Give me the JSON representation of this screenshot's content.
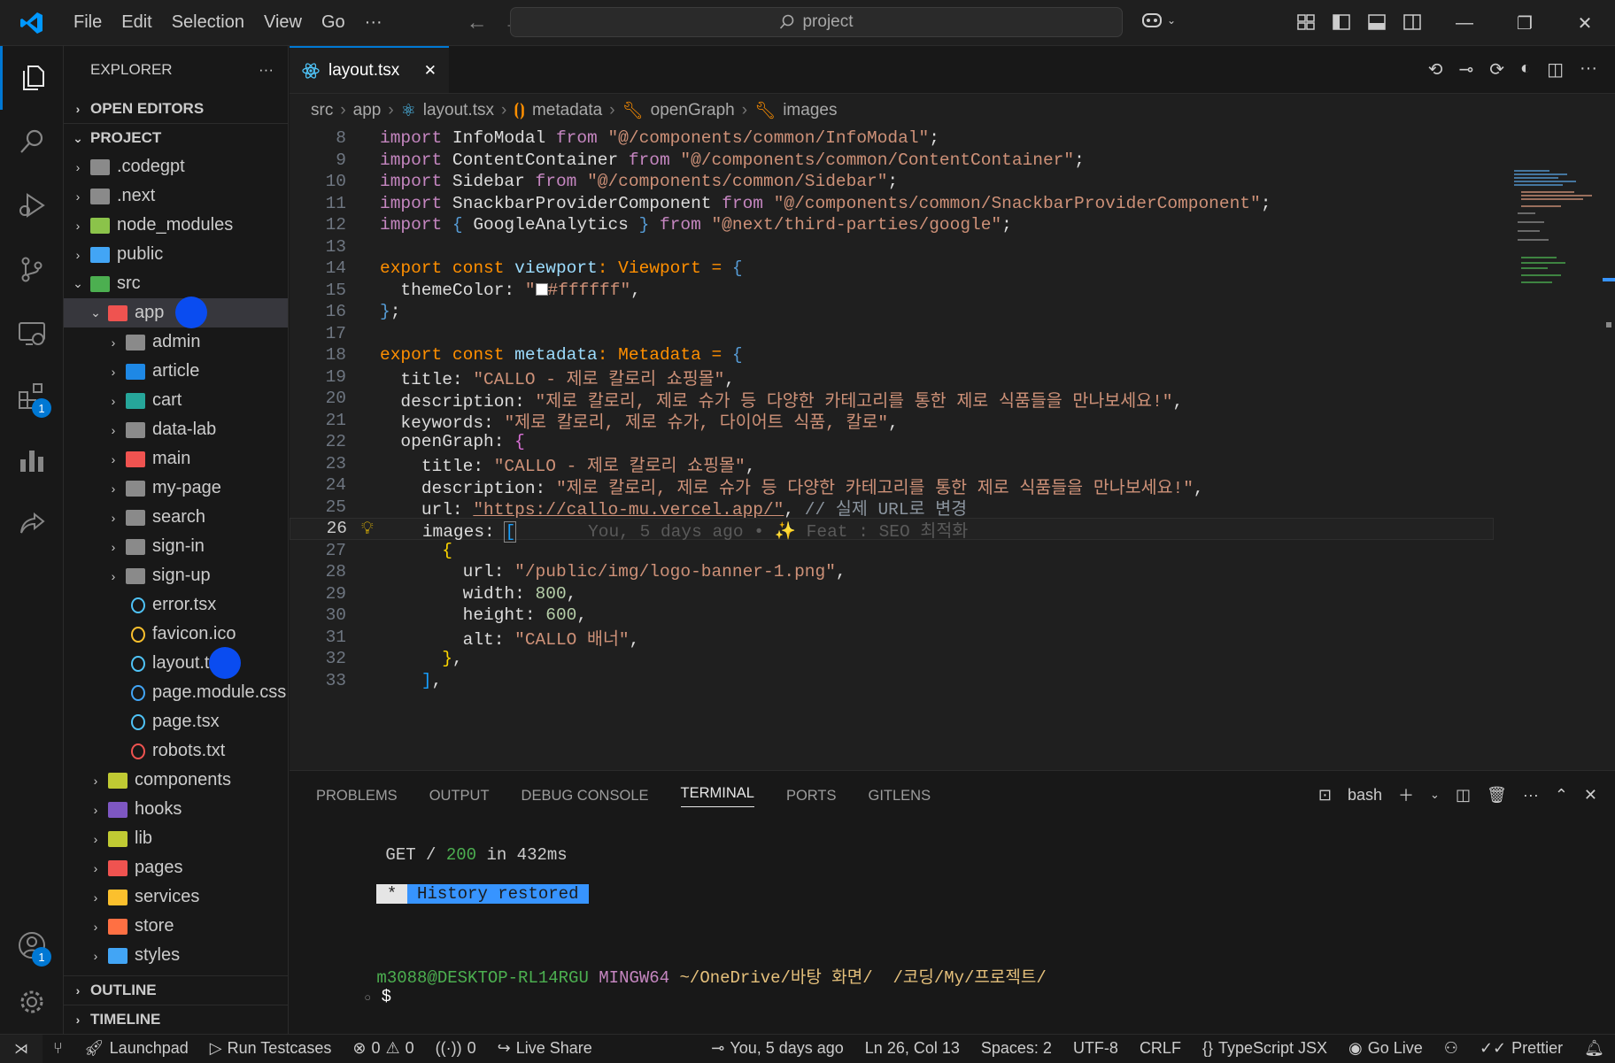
{
  "menu": [
    "File",
    "Edit",
    "Selection",
    "View",
    "Go",
    "···"
  ],
  "command_center": "project",
  "explorer": {
    "title": "EXPLORER",
    "more": "···",
    "open_editors": "OPEN EDITORS",
    "project": "PROJECT",
    "outline": "OUTLINE",
    "timeline": "TIMELINE",
    "tree": [
      {
        "label": ".codegpt",
        "level": 1,
        "chev": "›",
        "color": "#8a8a8a"
      },
      {
        "label": ".next",
        "level": 1,
        "chev": "›",
        "color": "#8a8a8a"
      },
      {
        "label": "node_modules",
        "level": 1,
        "chev": "›",
        "color": "#8bc34a"
      },
      {
        "label": "public",
        "level": 1,
        "chev": "›",
        "color": "#42a5f5"
      },
      {
        "label": "src",
        "level": 1,
        "chev": "⌄",
        "color": "#4caf50"
      },
      {
        "label": "app",
        "level": 2,
        "chev": "⌄",
        "color": "#ef5350",
        "selected": true
      },
      {
        "label": "admin",
        "level": 3,
        "chev": "›",
        "color": "#8a8a8a"
      },
      {
        "label": "article",
        "level": 3,
        "chev": "›",
        "color": "#1e88e5"
      },
      {
        "label": "cart",
        "level": 3,
        "chev": "›",
        "color": "#26a69a"
      },
      {
        "label": "data-lab",
        "level": 3,
        "chev": "›",
        "color": "#8a8a8a"
      },
      {
        "label": "main",
        "level": 3,
        "chev": "›",
        "color": "#ef5350"
      },
      {
        "label": "my-page",
        "level": 3,
        "chev": "›",
        "color": "#8a8a8a"
      },
      {
        "label": "search",
        "level": 3,
        "chev": "›",
        "color": "#8a8a8a"
      },
      {
        "label": "sign-in",
        "level": 3,
        "chev": "›",
        "color": "#8a8a8a"
      },
      {
        "label": "sign-up",
        "level": 3,
        "chev": "›",
        "color": "#8a8a8a"
      },
      {
        "label": "error.tsx",
        "level": 3,
        "chev": "",
        "color": "#4fc3f7",
        "file": true
      },
      {
        "label": "favicon.ico",
        "level": 3,
        "chev": "",
        "color": "#fbc02d",
        "file": true
      },
      {
        "label": "layout.tsx",
        "level": 3,
        "chev": "",
        "color": "#4fc3f7",
        "file": true
      },
      {
        "label": "page.module.css",
        "level": 3,
        "chev": "",
        "color": "#42a5f5",
        "file": true
      },
      {
        "label": "page.tsx",
        "level": 3,
        "chev": "",
        "color": "#4fc3f7",
        "file": true
      },
      {
        "label": "robots.txt",
        "level": 3,
        "chev": "",
        "color": "#ef5350",
        "file": true
      },
      {
        "label": "components",
        "level": 2,
        "chev": "›",
        "color": "#c0ca33"
      },
      {
        "label": "hooks",
        "level": 2,
        "chev": "›",
        "color": "#7e57c2"
      },
      {
        "label": "lib",
        "level": 2,
        "chev": "›",
        "color": "#c0ca33"
      },
      {
        "label": "pages",
        "level": 2,
        "chev": "›",
        "color": "#ef5350"
      },
      {
        "label": "services",
        "level": 2,
        "chev": "›",
        "color": "#fbc02d"
      },
      {
        "label": "store",
        "level": 2,
        "chev": "›",
        "color": "#ff7043"
      },
      {
        "label": "styles",
        "level": 2,
        "chev": "›",
        "color": "#42a5f5"
      }
    ]
  },
  "activity_badges": {
    "extensions": "1",
    "accounts": "1"
  },
  "tab": {
    "label": "layout.tsx",
    "close": "✕"
  },
  "breadcrumb": [
    "src",
    "app",
    "layout.tsx",
    "metadata",
    "openGraph",
    "images"
  ],
  "code_lines": [
    {
      "n": "8",
      "html": "<span class='k'>import</span> <span class='id'>InfoModal</span> <span class='k'>from</span> <span class='str'>\"@/components/common/InfoModal\"</span><span class='id'>;</span>"
    },
    {
      "n": "9",
      "html": "<span class='k'>import</span> <span class='id'>ContentContainer</span> <span class='k'>from</span> <span class='str'>\"@/components/common/ContentContainer\"</span><span class='id'>;</span>"
    },
    {
      "n": "10",
      "html": "<span class='k'>import</span> <span class='id'>Sidebar</span> <span class='k'>from</span> <span class='str'>\"@/components/common/Sidebar\"</span><span class='id'>;</span>"
    },
    {
      "n": "11",
      "html": "<span class='k'>import</span> <span class='id'>SnackbarProviderComponent</span> <span class='k'>from</span> <span class='str'>\"@/components/common/SnackbarProviderComponent\"</span><span class='id'>;</span>"
    },
    {
      "n": "12",
      "html": "<span class='k'>import</span> <span class='kw'>{</span> <span class='id'>GoogleAnalytics</span> <span class='kw'>}</span> <span class='k'>from</span> <span class='str'>\"@next/third-parties/google\"</span><span class='id'>;</span>"
    },
    {
      "n": "13",
      "html": ""
    },
    {
      "n": "14",
      "html": "<span class='ko'>export const</span> <span class='s'>viewport</span><span class='ko'>: Viewport =</span> <span class='kw'>{</span>"
    },
    {
      "n": "15",
      "html": "  <span class='id'>themeColor:</span> <span class='str'>\"</span><span style='display:inline-block;width:14px;height:14px;background:#fff;border:1px solid #888;vertical-align:-1px'></span><span class='str'>#ffffff\"</span><span class='id'>,</span>"
    },
    {
      "n": "16",
      "html": "<span class='kw'>}</span><span class='id'>;</span>"
    },
    {
      "n": "17",
      "html": ""
    },
    {
      "n": "18",
      "html": "<span class='ko'>export const</span> <span class='s'>metadata</span><span class='ko'>: Metadata =</span> <span class='kw'>{</span>"
    },
    {
      "n": "19",
      "html": "  <span class='id'>title:</span> <span class='str'>\"CALLO - 제로 칼로리 쇼핑몰\"</span><span class='id'>,</span>"
    },
    {
      "n": "20",
      "html": "  <span class='id'>description:</span> <span class='str'>\"제로 칼로리, 제로 슈가 등 다양한 카테고리를 통한 제로 식품들을 만나보세요!\"</span><span class='id'>,</span>"
    },
    {
      "n": "21",
      "html": "  <span class='id'>keywords:</span> <span class='str'>\"제로 칼로리, 제로 슈가, 다이어트 식품, 칼로\"</span><span class='id'>,</span>"
    },
    {
      "n": "22",
      "html": "  <span class='id'>openGraph:</span> <span class='brk2'>{</span>"
    },
    {
      "n": "23",
      "html": "    <span class='id'>title:</span> <span class='str'>\"CALLO - 제로 칼로리 쇼핑몰\"</span><span class='id'>,</span>"
    },
    {
      "n": "24",
      "html": "    <span class='id'>description:</span> <span class='str'>\"제로 칼로리, 제로 슈가 등 다양한 카테고리를 통한 제로 식품들을 만나보세요!\"</span><span class='id'>,</span>"
    },
    {
      "n": "25",
      "html": "    <span class='id'>url:</span> <span class='str' style='text-decoration:underline'>\"https://callo-mu.vercel.app/\"</span><span class='id'>,</span> <span class='cm'>// 실제 URL로 변경</span>"
    },
    {
      "n": "26",
      "html": "    <span class='id'>images:</span> <span class='brk3' style='outline:1px solid #888'>[</span>       <span class='blame'>You, 5 days ago • ✨ Feat : SEO 최적화</span>",
      "current": true
    },
    {
      "n": "27",
      "html": "      <span class='brk1'>{</span>"
    },
    {
      "n": "28",
      "html": "        <span class='id'>url:</span> <span class='str'>\"/public/img/logo-banner-1.png\"</span><span class='id'>,</span>"
    },
    {
      "n": "29",
      "html": "        <span class='id'>width:</span> <span class='n'>800</span><span class='id'>,</span>"
    },
    {
      "n": "30",
      "html": "        <span class='id'>height:</span> <span class='n'>600</span><span class='id'>,</span>"
    },
    {
      "n": "31",
      "html": "        <span class='id'>alt:</span> <span class='str'>\"CALLO 배너\"</span><span class='id'>,</span>"
    },
    {
      "n": "32",
      "html": "      <span class='brk1'>}</span><span class='id'>,</span>"
    },
    {
      "n": "33",
      "html": "    <span class='brk3'>]</span><span class='id'>,</span>"
    }
  ],
  "panel": {
    "tabs": [
      "PROBLEMS",
      "OUTPUT",
      "DEBUG CONSOLE",
      "TERMINAL",
      "PORTS",
      "GITLENS"
    ],
    "active_tab": "TERMINAL",
    "shell": "bash"
  },
  "terminal": {
    "line1_a": "GET / ",
    "line1_b": "200",
    "line1_c": " in 432ms",
    "history_star": " * ",
    "history_text": " History restored ",
    "prompt_user": "m3088@DESKTOP-RL14RGU",
    "prompt_env": "MINGW64",
    "prompt_path": "~/OneDrive/바탕 화면/  /코딩/My/프로젝트/",
    "prompt_char": "$"
  },
  "status": {
    "launchpad": "Launchpad",
    "run_testcases": "Run Testcases",
    "errors": "0",
    "warnings": "0",
    "ports": "0",
    "live_share": "Live Share",
    "blame": "You, 5 days ago",
    "position": "Ln 26, Col 13",
    "spaces": "Spaces: 2",
    "encoding": "UTF-8",
    "eol": "CRLF",
    "language": "TypeScript JSX",
    "go_live": "Go Live",
    "prettier": "Prettier"
  }
}
